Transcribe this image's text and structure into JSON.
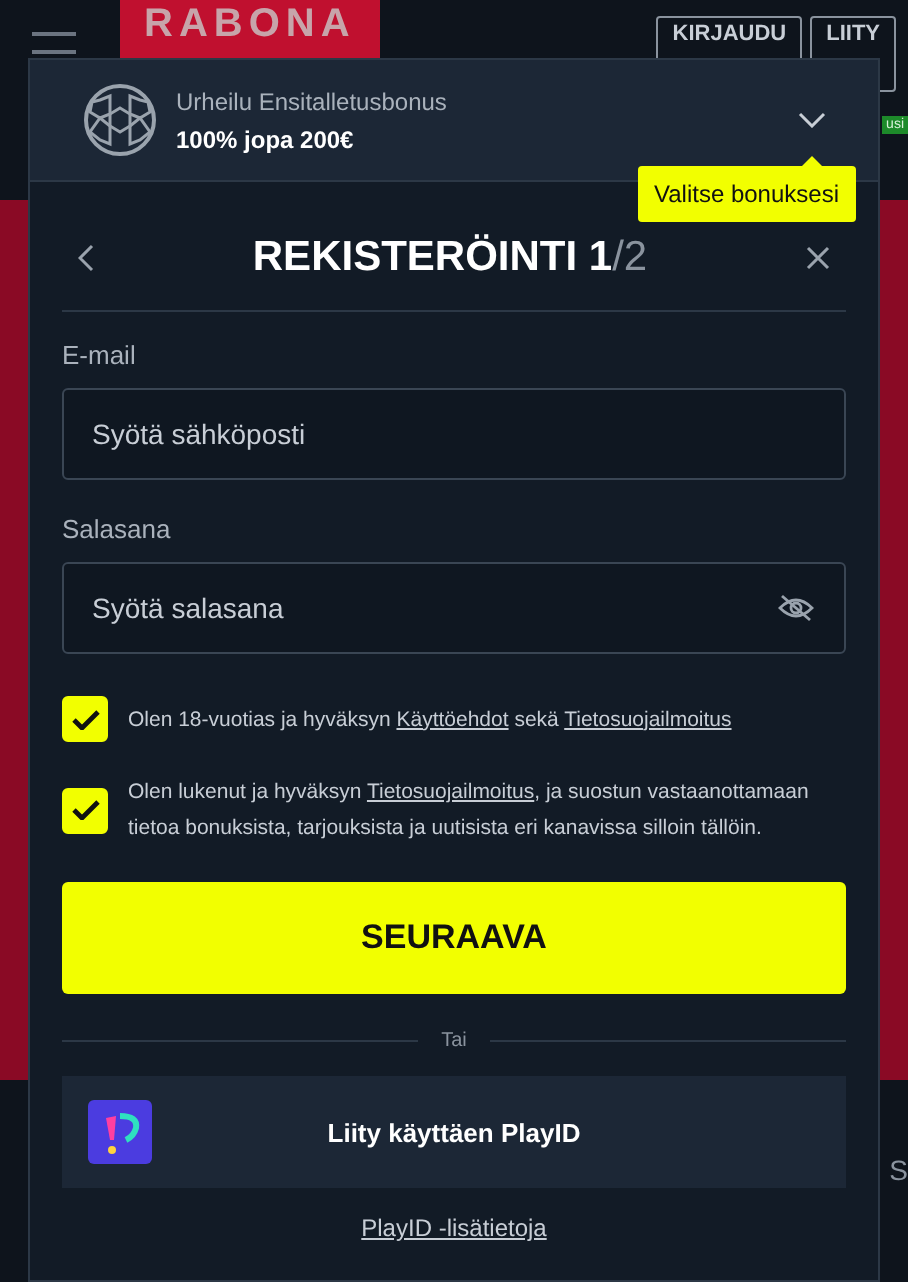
{
  "header": {
    "logo": "RABONA",
    "login": "KIRJAUDU",
    "join": "LIITY",
    "badge": "usi",
    "side_letter": "S"
  },
  "bonus": {
    "title": "Urheilu Ensitalletusbonus",
    "offer": "100% jopa 200€",
    "expanded": false
  },
  "tooltip": "Valitse bonuksesi",
  "form": {
    "title": "REKISTERÖINTI",
    "step": "1",
    "total": "/2",
    "fields": [
      {
        "label": "E-mail",
        "placeholder": "Syötä sähköposti",
        "kind": "text"
      },
      {
        "label": "Salasana",
        "placeholder": "Syötä salasana",
        "kind": "password"
      }
    ],
    "checkboxes": [
      {
        "checked": true,
        "parts": [
          {
            "kind": "text",
            "text": "Olen 18-vuotias ja hyväksyn "
          },
          {
            "kind": "link",
            "text": "Käyttöehdot"
          },
          {
            "kind": "text",
            "text": " sekä "
          },
          {
            "kind": "link",
            "text": "Tietosuojailmoitus"
          }
        ]
      },
      {
        "checked": true,
        "parts": [
          {
            "kind": "text",
            "text": "Olen lukenut ja hyväksyn "
          },
          {
            "kind": "link",
            "text": "Tietosuojailmoitus"
          },
          {
            "kind": "text",
            "text": ", ja suostun vastaanottamaan tietoa bonuksista, tarjouksista ja uutisista eri kanavissa silloin tällöin."
          }
        ]
      }
    ],
    "submit": "SEURAAVA",
    "divider": "Tai",
    "playid_button": "Liity käyttäen PlayID",
    "playid_link": "PlayID -lisätietoja"
  }
}
